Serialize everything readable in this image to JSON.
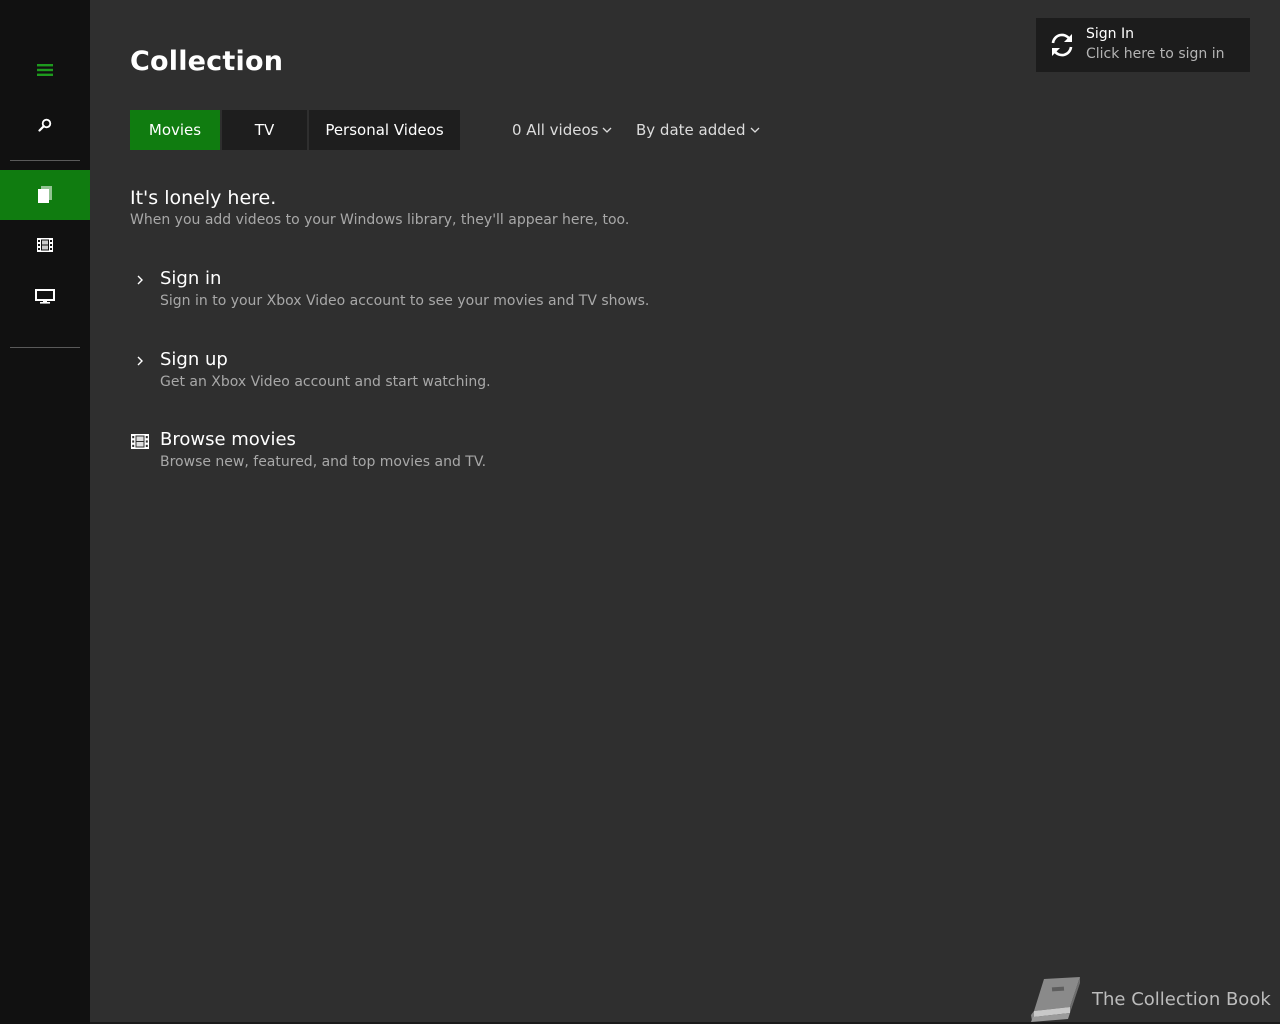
{
  "sidebar": {
    "items": [
      {
        "name": "hamburger-icon"
      },
      {
        "name": "search-icon"
      },
      {
        "name": "collection-icon",
        "active": true
      },
      {
        "name": "film-icon"
      },
      {
        "name": "tv-icon"
      }
    ],
    "accent_color": "#107c10"
  },
  "header": {
    "title": "Collection"
  },
  "tabs": [
    {
      "label": "Movies",
      "active": true
    },
    {
      "label": "TV",
      "active": false
    },
    {
      "label": "Personal Videos",
      "active": false
    }
  ],
  "filters": {
    "count_filter": "0 All videos",
    "sort": "By date added"
  },
  "empty_state": {
    "title": "It's lonely here.",
    "subtitle": "When you add videos to your Windows library, they'll appear here, too."
  },
  "actions": [
    {
      "title": "Sign in",
      "description": "Sign in to your Xbox Video account to see your movies and TV shows.",
      "icon": "chevron-right-icon"
    },
    {
      "title": "Sign up",
      "description": "Get an Xbox Video account and start watching.",
      "icon": "chevron-right-icon"
    },
    {
      "title": "Browse movies",
      "description": "Browse new, featured, and top movies and TV.",
      "icon": "film-icon"
    }
  ],
  "signin_panel": {
    "title": "Sign In",
    "subtitle": "Click here to sign in",
    "icon": "sync-icon"
  },
  "watermark": {
    "text": "The Collection Book",
    "icon": "book-icon"
  }
}
